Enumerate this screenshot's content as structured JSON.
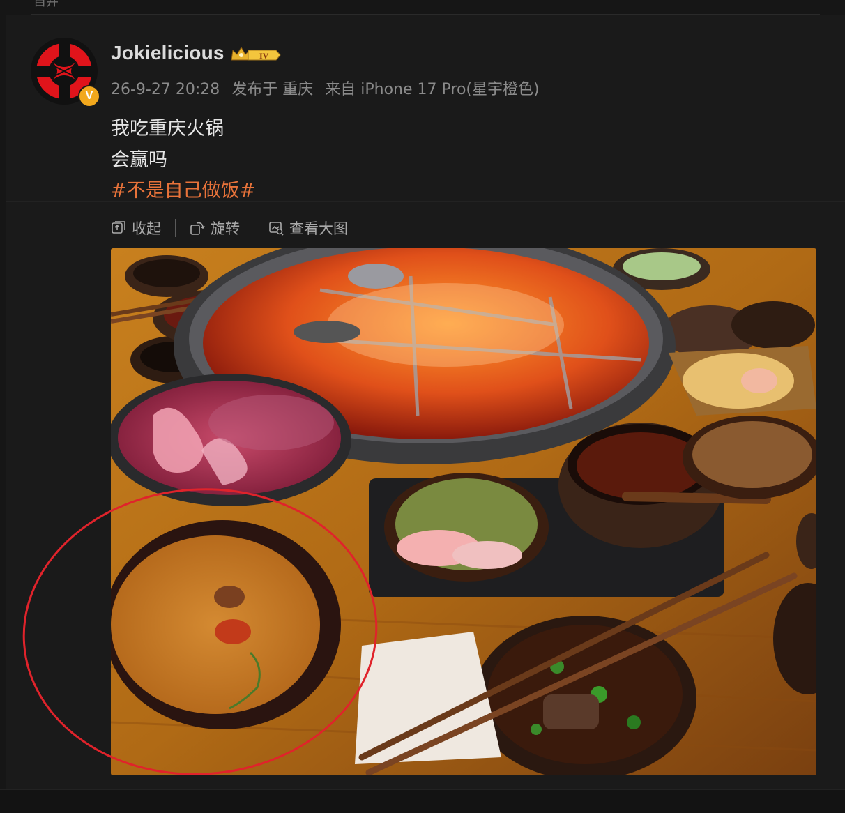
{
  "header": {
    "clipped_text": "自井"
  },
  "post": {
    "username": "Jokielicious",
    "verified_mark": "V",
    "level_badge": "IV",
    "meta": {
      "timestamp": "26-9-27 20:28",
      "location": "发布于 重庆",
      "device": "来自 iPhone 17 Pro(星宇橙色)"
    },
    "text_lines": [
      "我吃重庆火锅",
      "会赢吗"
    ],
    "hashtag": "#不是自己做饭#"
  },
  "toolbar": {
    "collapse_label": "收起",
    "rotate_label": "旋转",
    "view_large_label": "查看大图"
  },
  "annotation": {
    "type": "red-ellipse-highlight",
    "color": "#e0232b"
  },
  "colors": {
    "accent": "#e8733a",
    "background": "#1a1a1a",
    "badge_gold": "#f2a81d"
  },
  "icons": [
    "collapse-icon",
    "rotate-icon",
    "image-view-icon",
    "crown-icon",
    "verified-icon"
  ]
}
